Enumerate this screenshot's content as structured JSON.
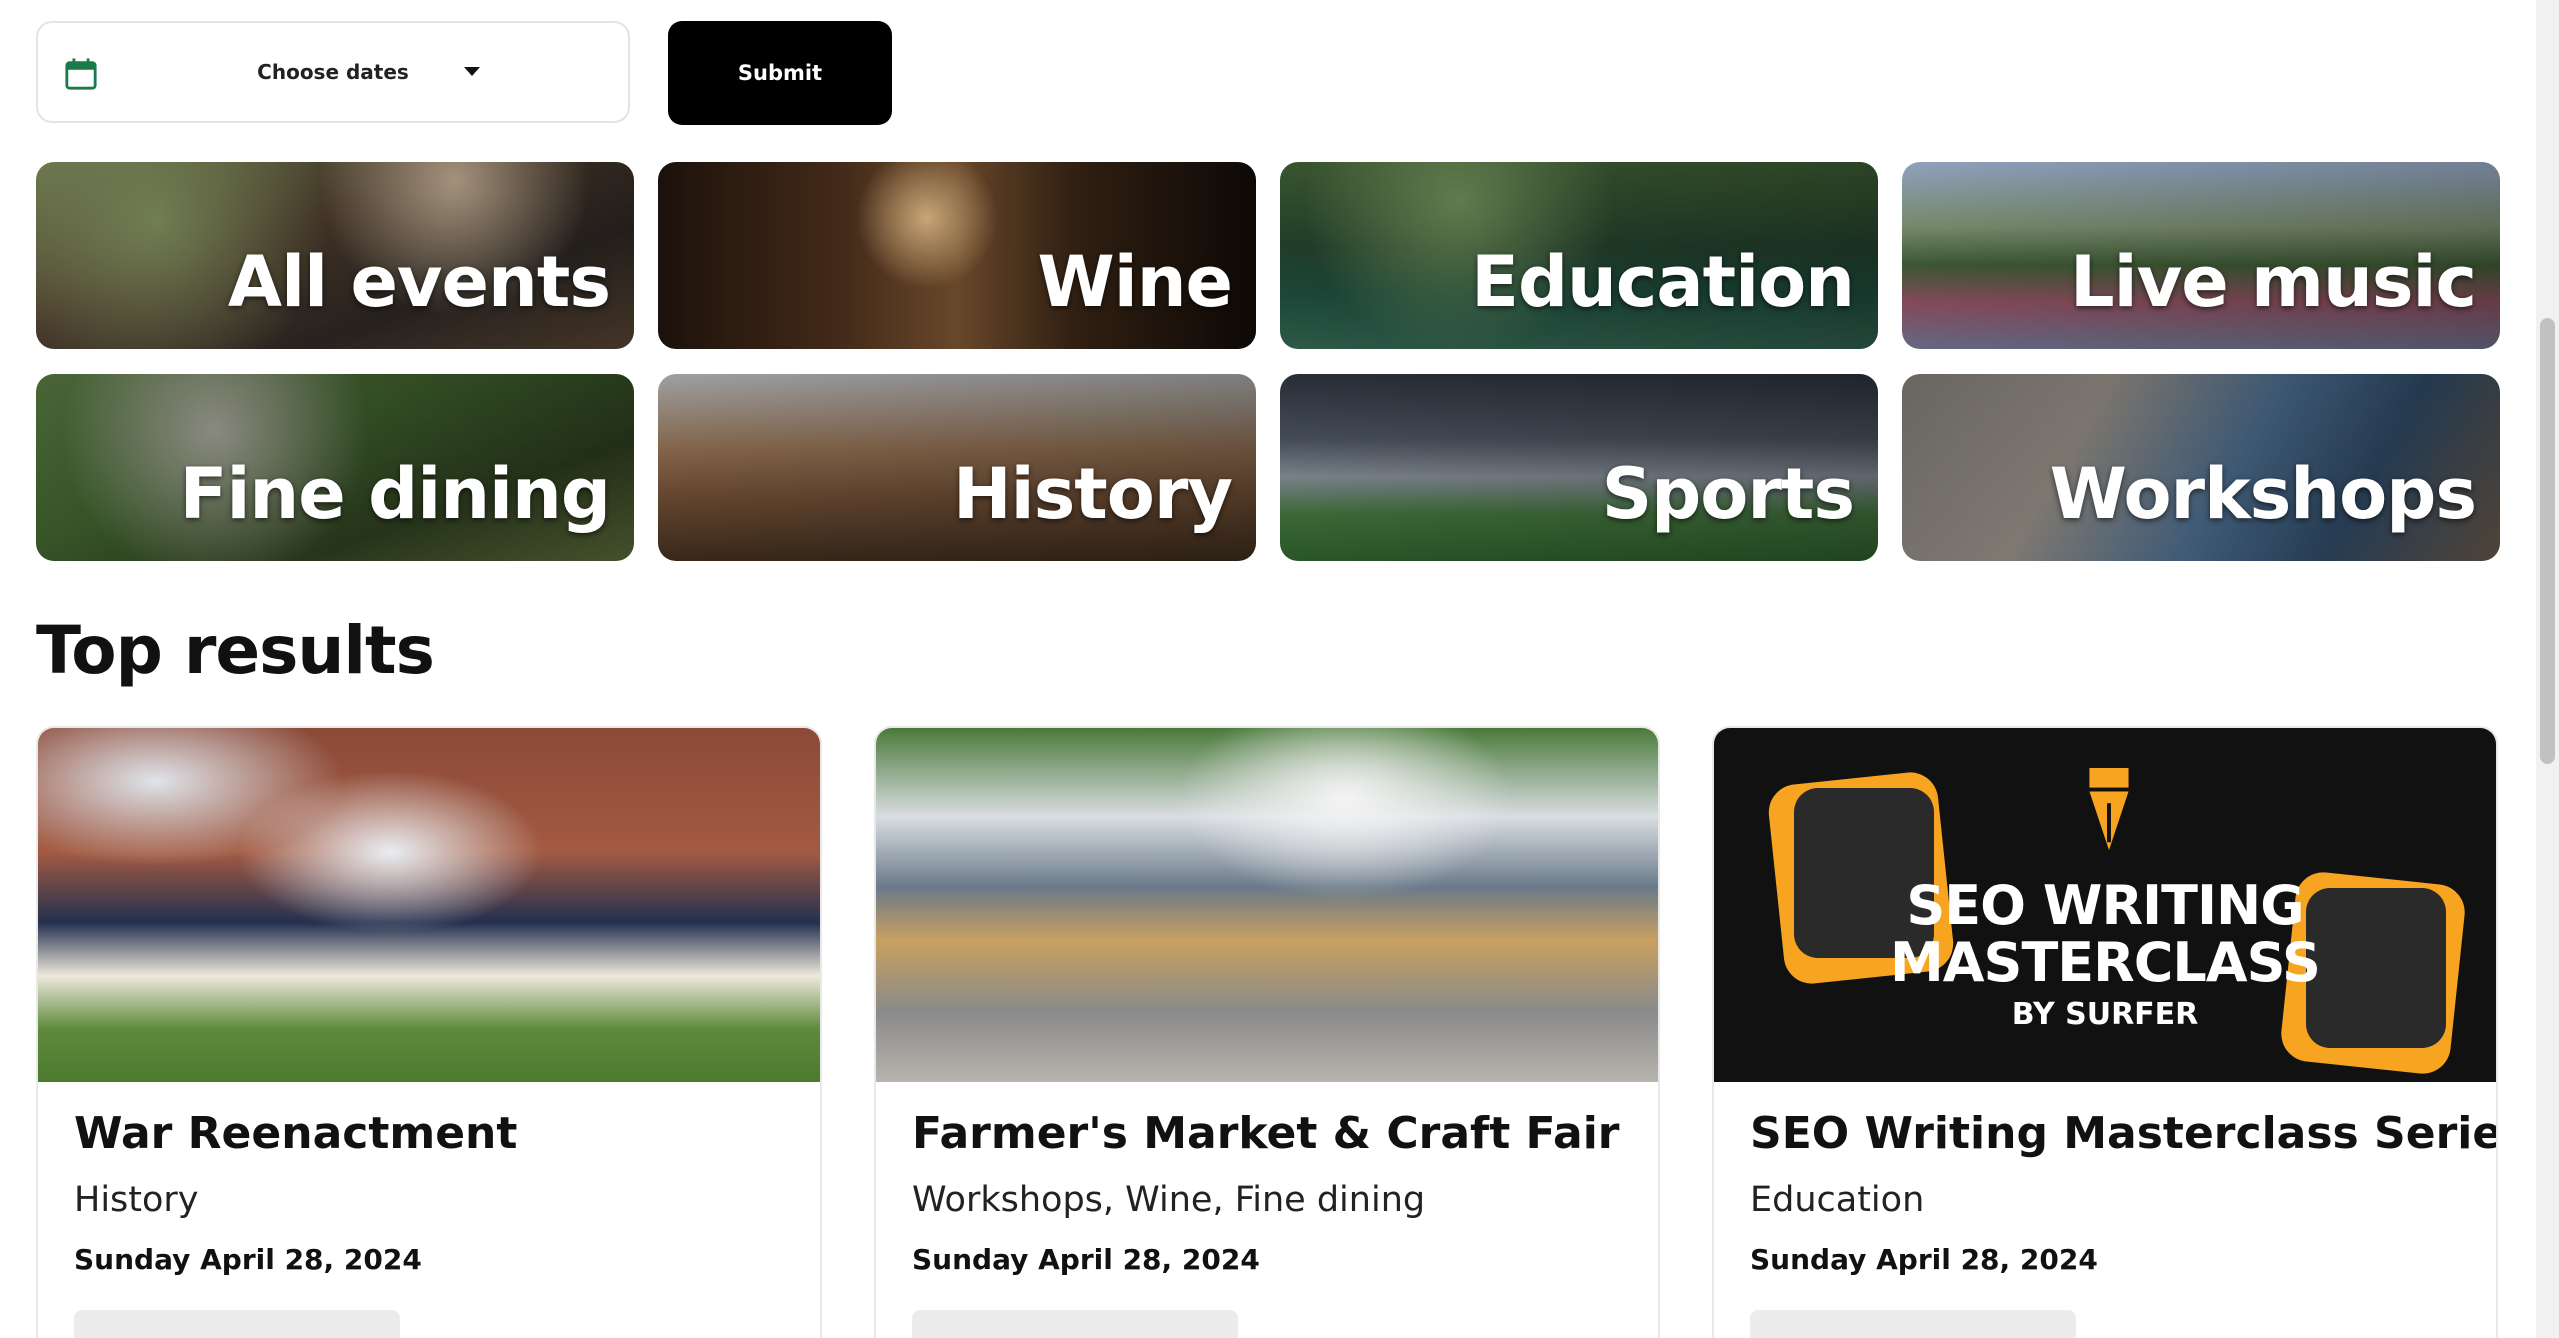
{
  "filters": {
    "date_label": "Choose dates",
    "submit_label": "Submit"
  },
  "categories": [
    {
      "label": "All events"
    },
    {
      "label": "Wine"
    },
    {
      "label": "Education"
    },
    {
      "label": "Live music"
    },
    {
      "label": "Fine dining"
    },
    {
      "label": "History"
    },
    {
      "label": "Sports"
    },
    {
      "label": "Workshops"
    }
  ],
  "top_results": {
    "heading": "Top results",
    "cards": [
      {
        "title": "War Reenactment",
        "categories": "History",
        "date": "Sunday April 28, 2024"
      },
      {
        "title": "Farmer's Market & Craft Fair",
        "categories": "Workshops, Wine, Fine dining",
        "date": "Sunday April 28, 2024"
      },
      {
        "title": "SEO Writing Masterclass Series",
        "categories": "Education",
        "date": "Sunday April 28, 2024",
        "image_text": {
          "line1": "SEO WRITING",
          "line2": "MASTERCLASS",
          "line3": "BY SURFER"
        }
      }
    ]
  },
  "colors": {
    "accent": "#000000",
    "brand_orange": "#f7a520"
  }
}
